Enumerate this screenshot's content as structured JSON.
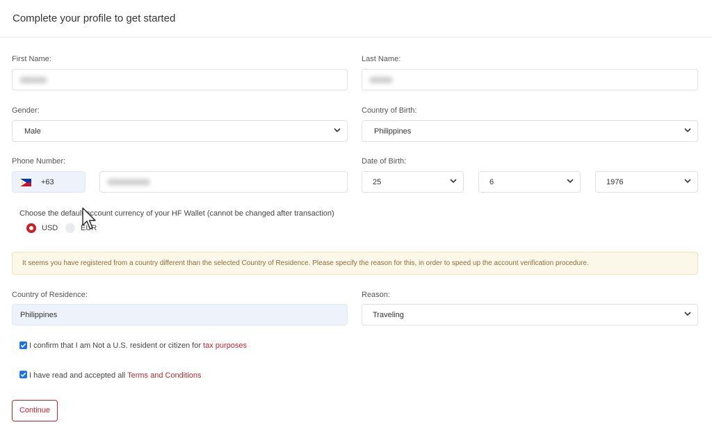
{
  "page": {
    "title": "Complete your profile to get started"
  },
  "first_name": {
    "label": "First Name:"
  },
  "last_name": {
    "label": "Last Name:"
  },
  "gender": {
    "label": "Gender:",
    "value": "Male"
  },
  "country_of_birth": {
    "label": "Country of Birth:",
    "value": "Philippines"
  },
  "phone": {
    "label": "Phone Number:",
    "prefix": "+63",
    "flag": "philippines-flag-icon"
  },
  "date_of_birth": {
    "label": "Date of Birth:",
    "day": "25",
    "month": "6",
    "year": "1976"
  },
  "currency": {
    "label": "Choose the default account currency of your HF Wallet (cannot be changed after transaction)",
    "options": [
      {
        "label": "USD",
        "selected": true
      },
      {
        "label": "EUR",
        "selected": false
      }
    ]
  },
  "alert": {
    "text": "It seems you have registered from a country different than the selected Country of Residence. Please specify the reason for this, in order to speed up the account verification procedure."
  },
  "country_of_residence": {
    "label": "Country of Residence:",
    "value": "Philippines"
  },
  "reason": {
    "label": "Reason:",
    "value": "Traveling"
  },
  "confirm_us": {
    "text": "I confirm that I am Not a U.S. resident or citizen for ",
    "link": "tax purposes",
    "checked": true
  },
  "terms": {
    "text": "I have read and accepted all ",
    "link": "Terms and Conditions",
    "checked": true
  },
  "continue_button": {
    "label": "Continue"
  },
  "colors": {
    "accent": "#c8202a",
    "checkbox": "#1a73e8",
    "alert_bg": "#fcf8e9",
    "alert_text": "#8a6d3b"
  }
}
